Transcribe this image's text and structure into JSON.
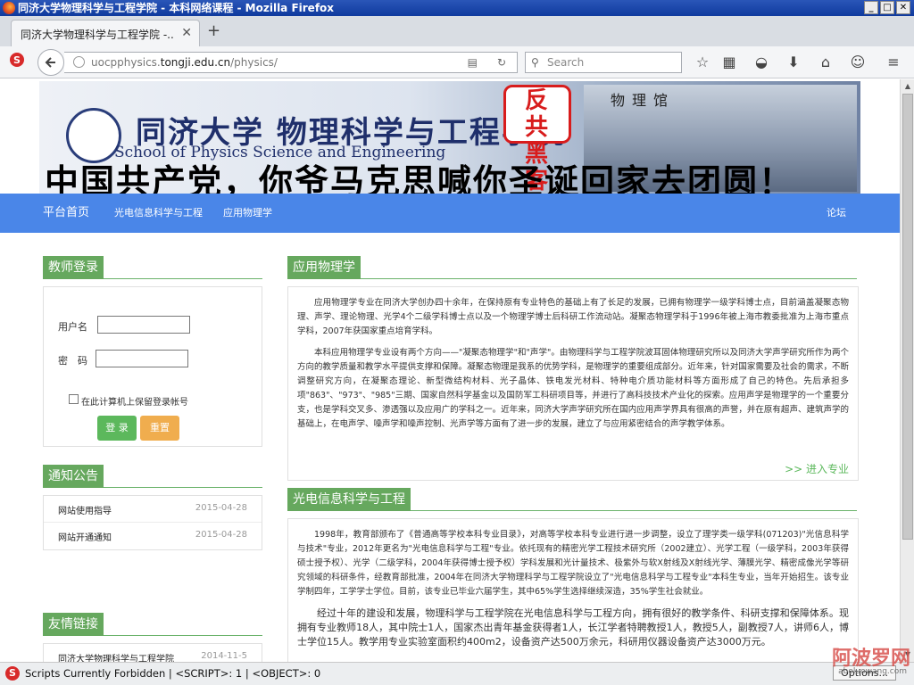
{
  "window": {
    "title": "同济大学物理科学与工程学院 - 本科网络课程 - Mozilla Firefox",
    "tab_title": "同济大学物理科学与工程学院 -...",
    "url_prefix": "uocpphysics.",
    "url_host": "tongji.edu.cn",
    "url_path": "/physics/",
    "search_placeholder": "Search"
  },
  "banner": {
    "school_name": "同济大学 物理科学与工程学院",
    "school_name_en": "School of Physics Science and Engineering",
    "stamp_text": "反共黑客",
    "building_title": "物理馆",
    "slogan": "中国共产党，你爷马克思喊你圣诞回家去团圆！"
  },
  "menu": {
    "home": "平台首页",
    "optoelectronic": "光电信息科学与工程",
    "applied_physics": "应用物理学",
    "forum": "论坛"
  },
  "login": {
    "title": "教师登录",
    "username_label": "用户名",
    "password_label": "密　码",
    "remember_label": "在此计算机上保留登录帐号",
    "login_button": "登 录",
    "reset_button": "重置"
  },
  "notices": {
    "title": "通知公告",
    "items": [
      {
        "title": "网站使用指导",
        "date": "2015-04-28"
      },
      {
        "title": "网站开通通知",
        "date": "2015-04-28"
      }
    ]
  },
  "links": {
    "title": "友情链接",
    "items": [
      {
        "title": "同济大学物理科学与工程学院",
        "date": "2014-11-5"
      }
    ]
  },
  "applied": {
    "title": "应用物理学",
    "p1": "应用物理学专业在同济大学创办四十余年，在保持原有专业特色的基础上有了长足的发展，已拥有物理学一级学科博士点，目前涵盖凝聚态物理、声学、理论物理、光学4个二级学科博士点以及一个物理学博士后科研工作流动站。凝聚态物理学科于1996年被上海市教委批准为上海市重点学科，2007年获国家重点培育学科。",
    "p2": "本科应用物理学专业设有两个方向——\"凝聚态物理学\"和\"声学\"。由物理科学与工程学院波耳固体物理研究所以及同济大学声学研究所作为两个方向的教学质量和教学水平提供支撑和保障。凝聚态物理是我系的优势学科，是物理学的重要组成部分。近年来，针对国家需要及社会的需求，不断调整研究方向，在凝聚态理论、新型微结构材料、光子晶体、铁电发光材料、特种电介质功能材料等方面形成了自己的特色。先后承担多项\"863\"、\"973\"、\"985\"三期、国家自然科学基金以及国防军工科研项目等，并进行了高科技技术产业化的探索。应用声学是物理学的一个重要分支，也是学科交叉多、渗透强以及应用广的学科之一。近年来，同济大学声学研究所在国内应用声学界具有很高的声誉，并在原有超声、建筑声学的基础上，在电声学、噪声学和噪声控制、光声学等方面有了进一步的发展，建立了与应用紧密结合的声学教学体系。",
    "more": ">> 进入专业"
  },
  "opto": {
    "title": "光电信息科学与工程",
    "p1": "1998年，教育部颁布了《普通高等学校本科专业目录》，对高等学校本科专业进行进一步调整，设立了理学类一级学科(071203)\"光信息科学与技术\"专业，2012年更名为\"光电信息科学与工程\"专业。依托现有的精密光学工程技术研究所（2002建立）、光学工程（一级学科，2003年获得硕士授予权）、光学（二级学科，2004年获得博士授予权）学科发展和光计量技术、极紫外与软X射线及X射线光学、薄膜光学、精密成像光学等研究领域的科研条件，经教育部批准，2004年在同济大学物理科学与工程学院设立了\"光电信息科学与工程专业\"本科生专业，当年开始招生。该专业学制四年，工学学士学位。目前，该专业已毕业六届学生，其中65%学生选择继续深造，35%学生社会就业。",
    "p2": "经过十年的建设和发展，物理科学与工程学院在光电信息科学与工程方向，拥有很好的教学条件、科研支撑和保障体系。现拥有专业教师18人，其中院士1人，国家杰出青年基金获得者1人，长江学者特聘教授1人，教授5人，副教授7人，讲师6人，博士学位15人。教学用专业实验室面积约400m2，设备资产达500万余元，科研用仪器设备资产达3000万元。"
  },
  "status": {
    "text": "Scripts Currently Forbidden | <SCRIPT>: 1 | <OBJECT>: 0",
    "options": "Options..."
  },
  "watermark": {
    "main": "阿波罗网",
    "sub": "aboluowang.com"
  }
}
